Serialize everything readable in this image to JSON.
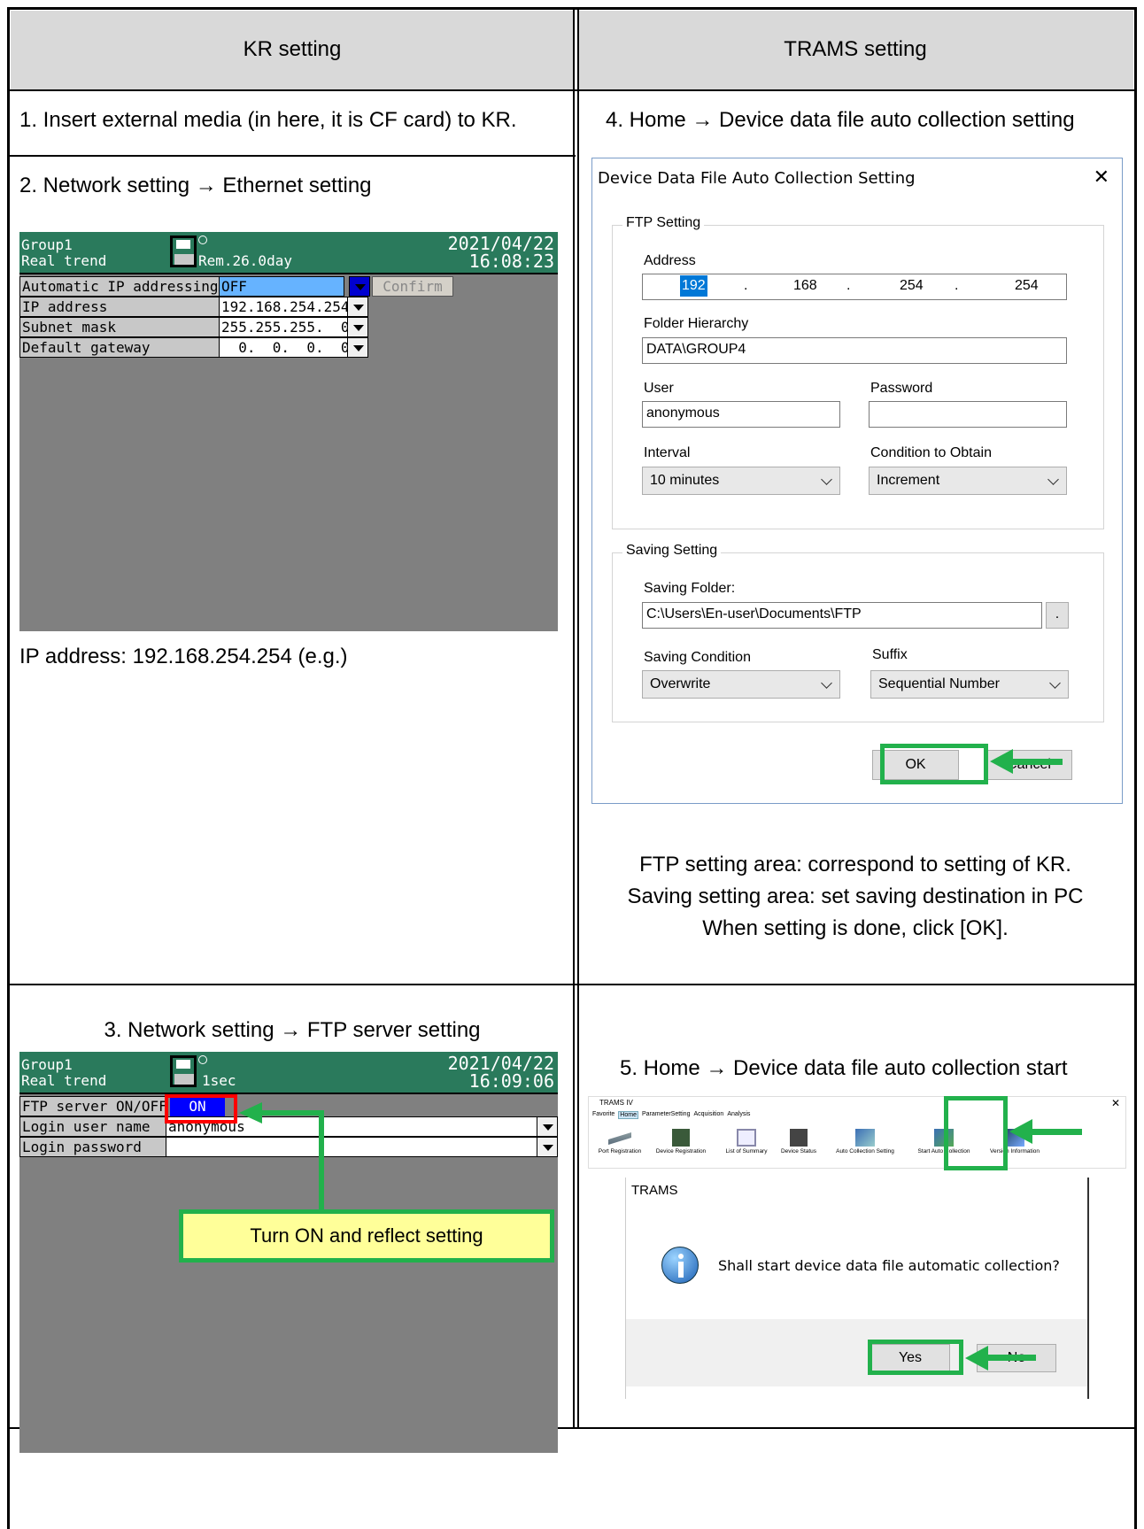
{
  "headers": {
    "left": "KR setting",
    "right": "TRAMS setting"
  },
  "steps": {
    "s1": "1. Insert external media (in here, it is CF card) to KR.",
    "s2": "2. Network setting → Ethernet setting",
    "s3": "3. Network setting → FTP server setting",
    "s4": "4. Home → Device data file auto collection setting",
    "s5": "5. Home → Device data file auto collection start"
  },
  "ethernet_screen": {
    "group": "Group1",
    "mode": "Real trend",
    "remaining": "Rem.26.0day",
    "date": "2021/04/22",
    "time": "16:08:23",
    "rows": [
      {
        "label": "Automatic IP addressing",
        "value": "OFF"
      },
      {
        "label": "IP address",
        "value": "192.168.254.254"
      },
      {
        "label": "Subnet mask",
        "value": "255.255.255.  0"
      },
      {
        "label": "Default gateway",
        "value": "  0.  0.  0.  0"
      }
    ],
    "confirm": "Confirm"
  },
  "ip_note": "IP address: 192.168.254.254 (e.g.)",
  "ftp_screen": {
    "group": "Group1",
    "mode": "Real trend",
    "interval": "1sec",
    "date": "2021/04/22",
    "time": "16:09:06",
    "rows": [
      {
        "label": "FTP server ON/OFF",
        "value": "ON"
      },
      {
        "label": "Login user name",
        "value": "anonymous"
      },
      {
        "label": "Login password",
        "value": ""
      }
    ],
    "callout": "Turn ON and reflect setting"
  },
  "dialog": {
    "title": "Device Data File Auto Collection Setting",
    "close": "✕",
    "ftp_group": "FTP Setting",
    "address_label": "Address",
    "address": [
      "192",
      "168",
      "254",
      "254"
    ],
    "dot": ".",
    "folder_label": "Folder Hierarchy",
    "folder": "DATA\\GROUP4",
    "user_label": "User",
    "user": "anonymous",
    "password_label": "Password",
    "password": "",
    "interval_label": "Interval",
    "interval": "10 minutes",
    "condition_label": "Condition to Obtain",
    "condition": "Increment",
    "saving_group": "Saving Setting",
    "saving_folder_label": "Saving Folder:",
    "saving_folder": "C:\\Users\\En-user\\Documents\\FTP",
    "browse": ".",
    "saving_condition_label": "Saving Condition",
    "saving_condition": "Overwrite",
    "suffix_label": "Suffix",
    "suffix": "Sequential Number",
    "ok": "OK",
    "cancel": "Cancel"
  },
  "notes": [
    "FTP setting area: correspond to setting of KR.",
    "Saving setting area: set saving destination in PC",
    "When setting is done, click [OK]."
  ],
  "trams": {
    "app_title": "TRAMS IV",
    "close": "✕",
    "tabs": [
      "Favorite",
      "Home",
      "ParameterSetting",
      "Acquisition",
      "Analysis"
    ],
    "tools": [
      "Port Registration",
      "Device Registration",
      "List of Summary",
      "Device Status",
      "Auto Collection Setting",
      "Start Auto Collection",
      "Version Information"
    ]
  },
  "confirm_dialog": {
    "title": "TRAMS",
    "message": "Shall start device data file automatic collection?",
    "yes": "Yes",
    "no": "No"
  }
}
